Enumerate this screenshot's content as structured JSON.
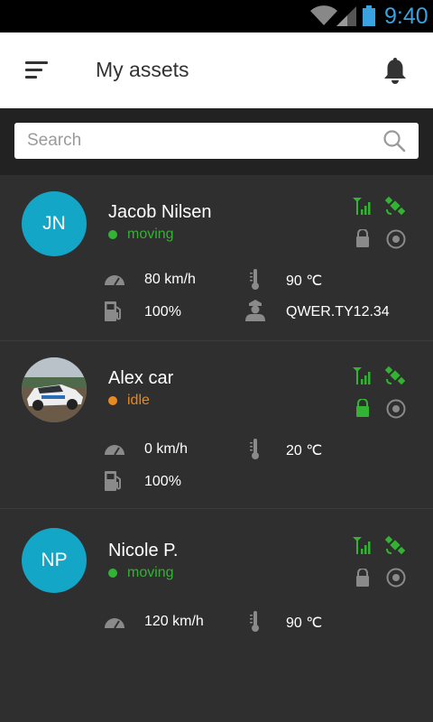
{
  "status_bar": {
    "time": "9:40"
  },
  "header": {
    "title": "My assets"
  },
  "search": {
    "placeholder": "Search"
  },
  "colors": {
    "moving": "#33b233",
    "idle": "#e88a1f",
    "accent": "#13a6c6",
    "icon_gray": "#8a8a8a"
  },
  "assets": [
    {
      "initials": "JN",
      "name": "Jacob Nilsen",
      "status": "moving",
      "locked": false,
      "speed": "80 km/h",
      "temperature": "90 ℃",
      "fuel": "100%",
      "driver_id": "QWER.TY12.34"
    },
    {
      "initials": "",
      "name": "Alex car",
      "status": "idle",
      "locked": true,
      "speed": "0 km/h",
      "temperature": "20 ℃",
      "fuel": "100%"
    },
    {
      "initials": "NP",
      "name": "Nicole P.",
      "status": "moving",
      "locked": false,
      "speed": "120 km/h",
      "temperature": "90 ℃"
    }
  ]
}
